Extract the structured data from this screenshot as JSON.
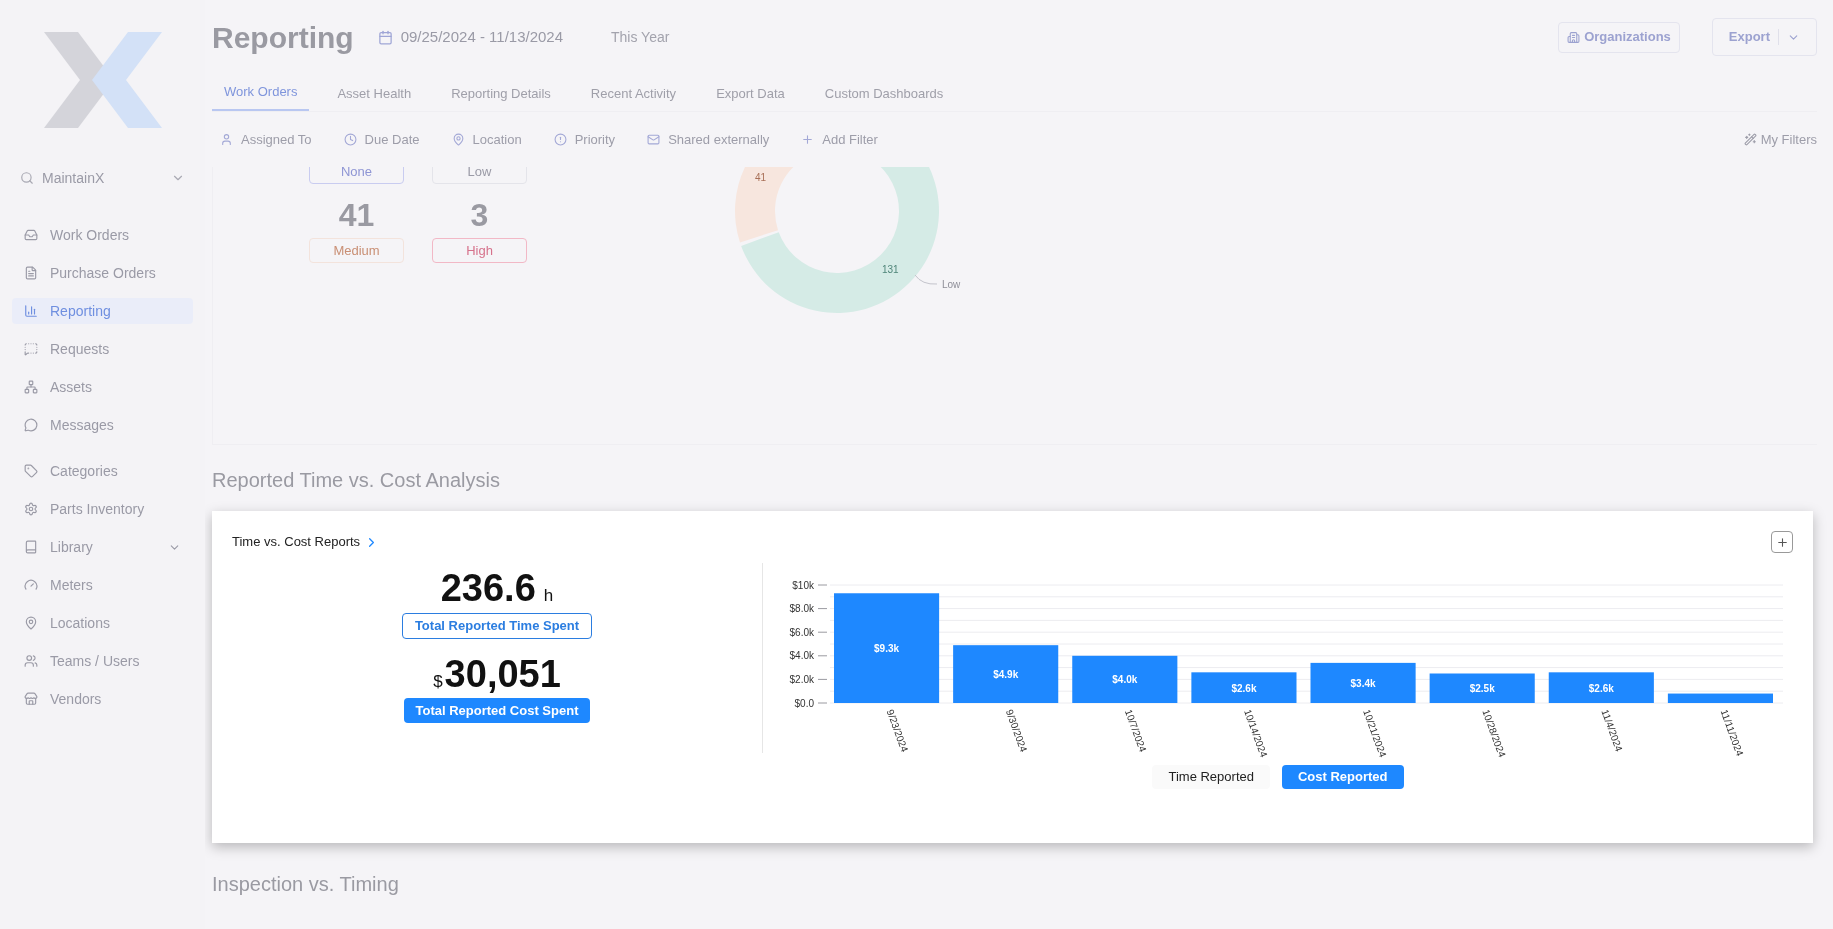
{
  "sidebar": {
    "workspace": "MaintainX",
    "items": [
      {
        "label": "Work Orders",
        "selected": false,
        "kind": "link"
      },
      {
        "label": "Purchase Orders",
        "selected": false,
        "kind": "link"
      },
      {
        "label": "Reporting",
        "selected": true,
        "kind": "link"
      },
      {
        "label": "Requests",
        "selected": false,
        "kind": "link"
      },
      {
        "label": "Assets",
        "selected": false,
        "kind": "link"
      },
      {
        "label": "Messages",
        "selected": false,
        "kind": "link"
      },
      {
        "label": "Categories",
        "selected": false,
        "kind": "link"
      },
      {
        "label": "Parts Inventory",
        "selected": false,
        "kind": "link"
      },
      {
        "label": "Library",
        "selected": false,
        "kind": "group"
      },
      {
        "label": "Meters",
        "selected": false,
        "kind": "link"
      },
      {
        "label": "Locations",
        "selected": false,
        "kind": "link"
      },
      {
        "label": "Teams / Users",
        "selected": false,
        "kind": "link"
      },
      {
        "label": "Vendors",
        "selected": false,
        "kind": "link"
      }
    ]
  },
  "header": {
    "title": "Reporting",
    "date_range": "09/25/2024 - 11/13/2024",
    "period": "This Year",
    "organizations": "Organizations",
    "export": "Export"
  },
  "tabs": [
    {
      "label": "Work Orders",
      "selected": true
    },
    {
      "label": "Asset Health",
      "selected": false
    },
    {
      "label": "Reporting Details",
      "selected": false
    },
    {
      "label": "Recent Activity",
      "selected": false
    },
    {
      "label": "Export Data",
      "selected": false
    },
    {
      "label": "Custom Dashboards",
      "selected": false
    }
  ],
  "filters": [
    "Assigned To",
    "Due Date",
    "Location",
    "Priority",
    "Shared externally",
    "Add Filter"
  ],
  "my_filters": "My Filters",
  "priority_cards": [
    {
      "label": "None",
      "color": "#c9ccf0"
    },
    {
      "label": "Low",
      "color": "#e4e4ea"
    },
    {
      "count": "41",
      "label": "Medium",
      "color": "#f3e3dc"
    },
    {
      "count": "3",
      "label": "High",
      "color": "#f2b8c6"
    }
  ],
  "donut": {
    "segment_labels": [
      "41",
      "131"
    ],
    "legend_label": "Low"
  },
  "section_title": "Reported Time vs. Cost Analysis",
  "report_card": {
    "title": "Time vs. Cost Reports",
    "time": {
      "value": "236.6",
      "unit": "h",
      "label": "Total Reported Time Spent"
    },
    "cost": {
      "currency": "$",
      "value": "30,051",
      "label": "Total Reported Cost Spent"
    },
    "chart_data": {
      "type": "bar",
      "categories": [
        "9/23/2024",
        "9/30/2024",
        "10/7/2024",
        "10/14/2024",
        "10/21/2024",
        "10/28/2024",
        "11/4/2024",
        "11/11/2024"
      ],
      "grid": true,
      "series": [
        {
          "color": "#1e88ff",
          "values": [
            9300,
            4900,
            4000,
            2600,
            3400,
            2500,
            2600,
            800
          ]
        }
      ],
      "ylim": [
        0,
        10000
      ],
      "yticks": [
        {
          "value": 0,
          "label": "$0.0"
        },
        {
          "value": 2000,
          "label": "$2.0k"
        },
        {
          "value": 4000,
          "label": "$4.0k"
        },
        {
          "value": 6000,
          "label": "$6.0k"
        },
        {
          "value": 8000,
          "label": "$8.0k"
        },
        {
          "value": 10000,
          "label": "$10k"
        }
      ],
      "value_labels": [
        "$9.3k",
        "$4.9k",
        "$4.0k",
        "$2.6k",
        "$3.4k",
        "$2.5k",
        "$2.6k",
        null
      ]
    },
    "toggle": [
      {
        "label": "Time Reported",
        "selected": false
      },
      {
        "label": "Cost Reported",
        "selected": true
      }
    ]
  },
  "next_section_title": "Inspection vs. Timing"
}
